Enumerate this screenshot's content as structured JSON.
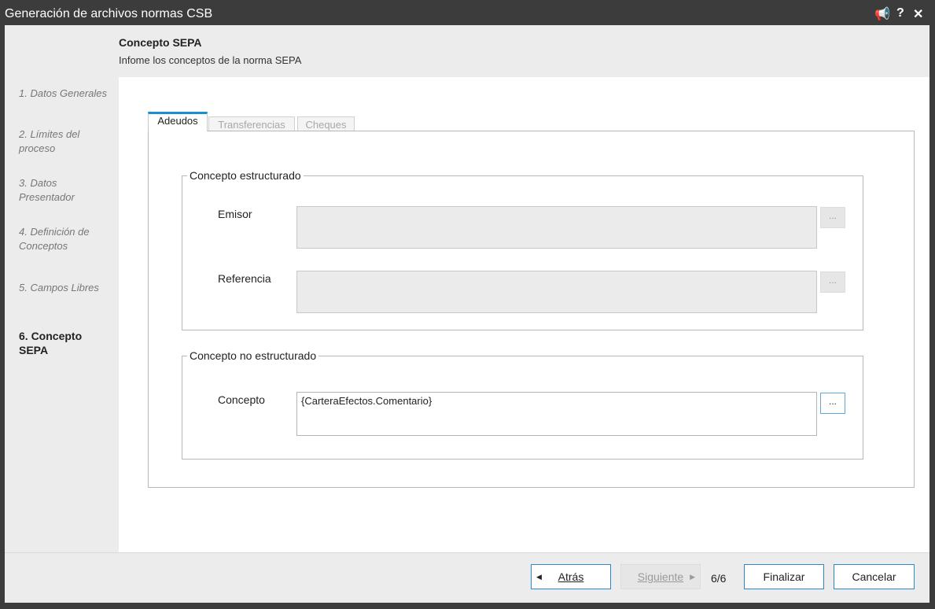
{
  "window": {
    "title": "Generación de archivos normas CSB",
    "controls": {
      "pin": "📢",
      "help": "?",
      "close": "✕"
    }
  },
  "header": {
    "title": "Concepto SEPA",
    "subtitle": "Infome los conceptos de la norma SEPA"
  },
  "steps": [
    {
      "label": "1. Datos Generales",
      "active": false
    },
    {
      "label": "2. Límites del proceso",
      "active": false
    },
    {
      "label": "3. Datos Presentador",
      "active": false
    },
    {
      "label": "4. Definición de Conceptos",
      "active": false
    },
    {
      "label": "5. Campos Libres",
      "active": false
    },
    {
      "label": "6. Concepto SEPA",
      "active": true
    }
  ],
  "tabs": [
    {
      "label": "Adeudos",
      "active": true
    },
    {
      "label": "Transferencias",
      "active": false
    },
    {
      "label": "Cheques",
      "active": false
    }
  ],
  "structured": {
    "legend": "Concepto estructurado",
    "emisor": {
      "label": "Emisor",
      "value": "",
      "button": "..."
    },
    "referencia": {
      "label": "Referencia",
      "value": "",
      "button": "..."
    }
  },
  "unstructured": {
    "legend": "Concepto no estructurado",
    "concepto": {
      "label": "Concepto",
      "value": "{CarteraEfectos.Comentario}",
      "button": "..."
    }
  },
  "footer": {
    "back": "Atrás",
    "next": "Siguiente",
    "page": "6/6",
    "finish": "Finalizar",
    "cancel": "Cancelar"
  },
  "colors": {
    "accent": "#1a8fd0",
    "titlebar": "#3c3c3c",
    "button_border": "#2b88c8"
  }
}
